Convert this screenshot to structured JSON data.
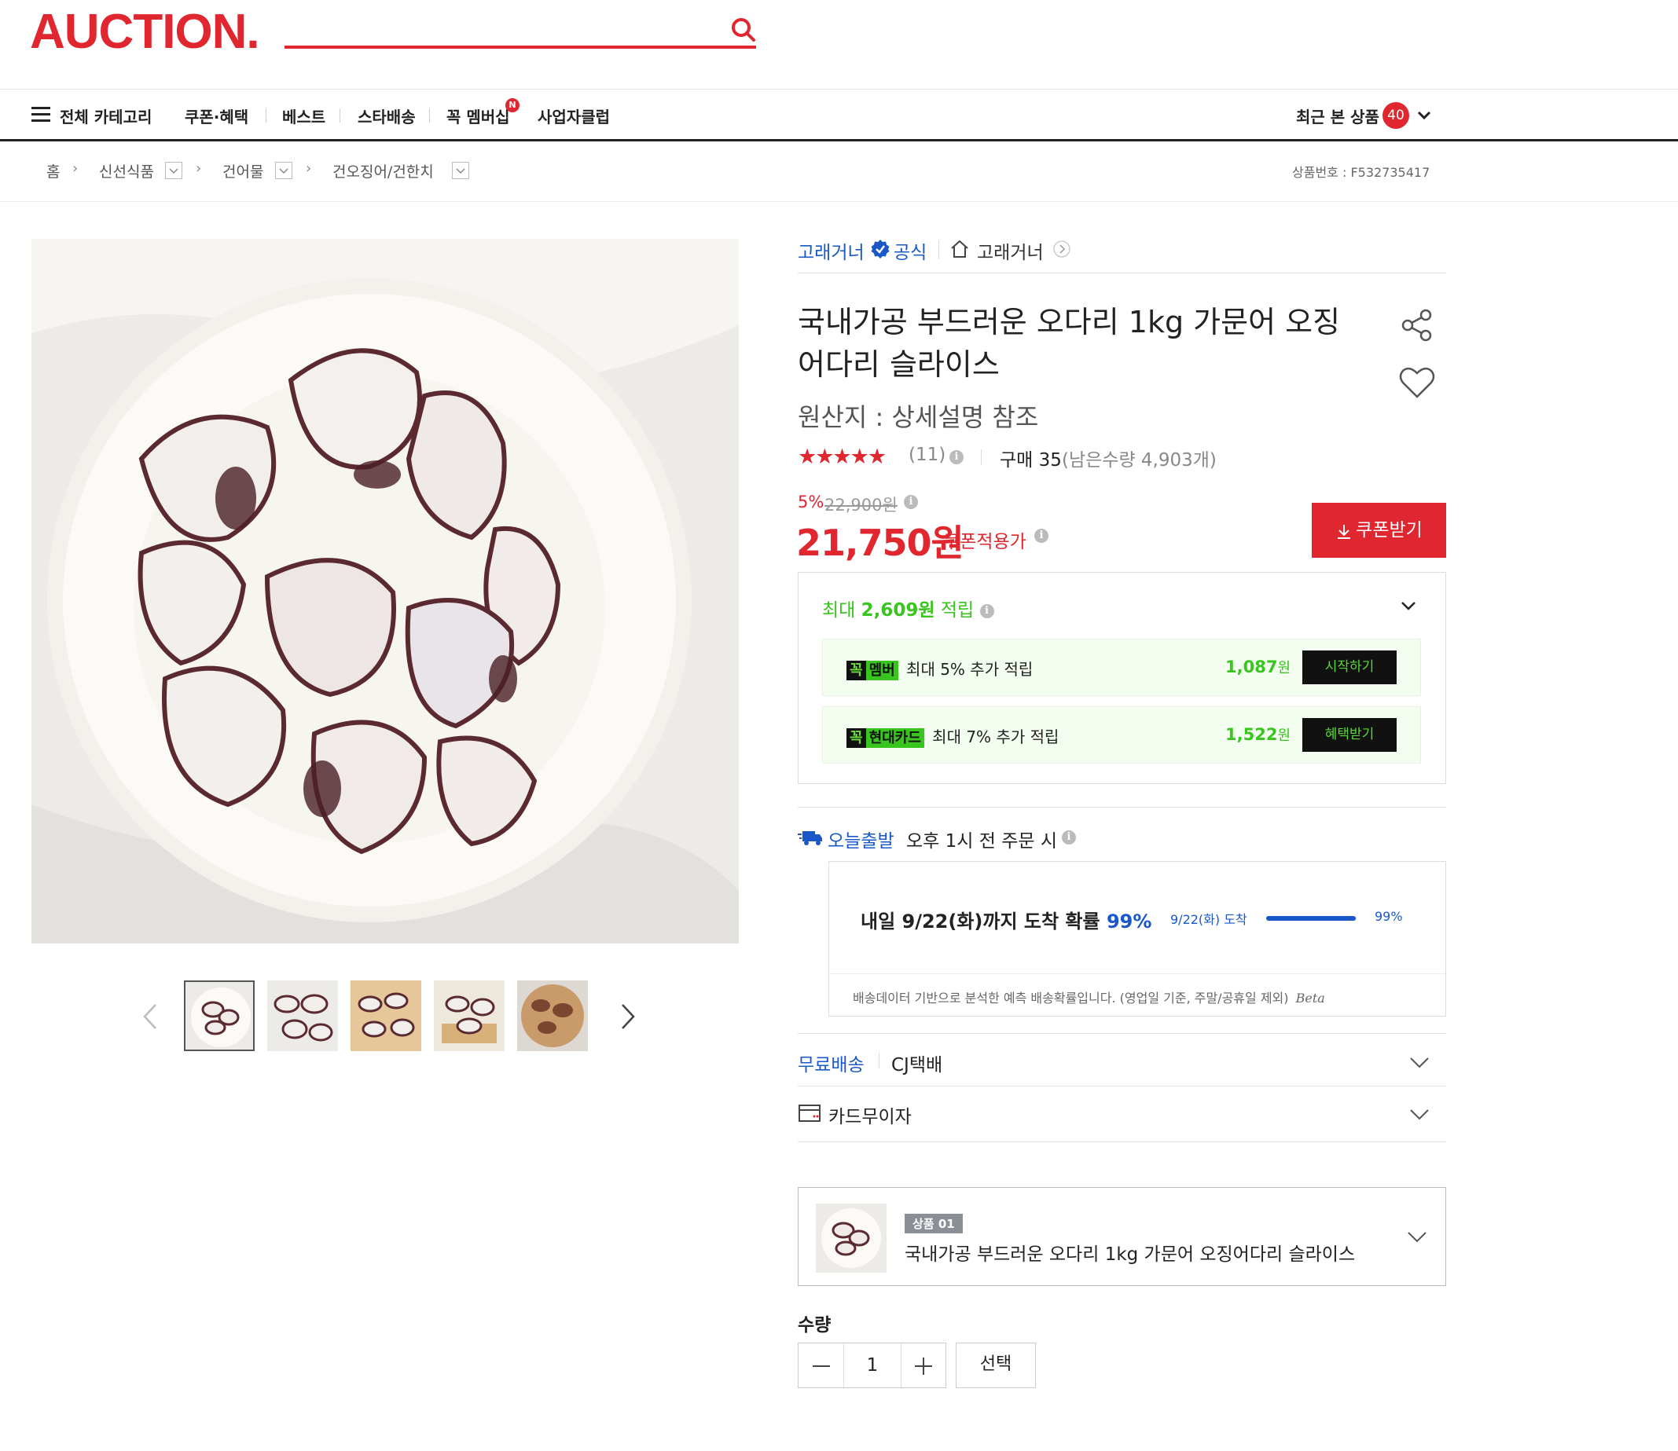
{
  "header": {
    "logo": "AUCTION."
  },
  "nav": {
    "all_categories": "전체 카테고리",
    "items": [
      "쿠폰·혜택",
      "베스트",
      "스타배송",
      "꼭 멤버십",
      "사업자클럽"
    ],
    "membership_badge": "N",
    "recent_label": "최근 본 상품",
    "recent_count": "40"
  },
  "breadcrumb": {
    "items": [
      "홈",
      "신선식품",
      "건어물",
      "건오징어/건한치"
    ],
    "product_no": "상품번호 : F532735417"
  },
  "seller": {
    "name": "고래거너",
    "official_label": "공식",
    "store_name": "고래거너"
  },
  "product": {
    "title": "국내가공 부드러운 오다리 1kg 가문어 오징어다리 슬라이스",
    "origin": "원산지 : 상세설명 참조",
    "rating_stars": "★★★★★",
    "rating": 5,
    "review_count": "(11)",
    "purchases": "구매 35",
    "stock": "(남은수량 4,903개)",
    "discount_pct": "5%",
    "original_price": "22,900원",
    "price": "21,750원",
    "coupon_price_label": "쿠폰적용가",
    "coupon_button": "쿠폰받기"
  },
  "rewards": {
    "header_prefix": "최대",
    "header_amount": "2,609원",
    "header_suffix": "적립",
    "rows": [
      {
        "tag1": "꼭",
        "tag2": "멤버",
        "text": "최대 5% 추가 적립",
        "amount": "1,087",
        "unit": "원",
        "button": "시작하기"
      },
      {
        "tag1": "꼭",
        "tag2": "현대카드",
        "text": "최대 7% 추가 적립",
        "amount": "1,522",
        "unit": "원",
        "button": "혜택받기"
      }
    ]
  },
  "shipping": {
    "today_label": "오늘출발",
    "today_condition": "오후 1시 전 주문 시",
    "arrival_text": "내일 9/22(화)까지 도착 확률",
    "arrival_pct": "99%",
    "bar_label": "9/22(화) 도착",
    "bar_pct_text": "99%",
    "bar_fraction": 0.99,
    "note": "배송데이터 기반으로 분석한 예측 배송확률입니다. (영업일 기준, 주말/공휴일 제외)",
    "beta": "Beta",
    "free_label": "무료배송",
    "courier": "CJ택배",
    "card_label": "카드무이자"
  },
  "option": {
    "tag": "상품 01",
    "name": "국내가공 부드러운 오다리 1kg 가문어 오징어다리 슬라이스"
  },
  "quantity": {
    "label": "수량",
    "value": "1",
    "select_button": "선택"
  },
  "colors": {
    "brand": "#e0262f",
    "link_blue": "#1a58c8",
    "reward_green": "#38c51e"
  }
}
